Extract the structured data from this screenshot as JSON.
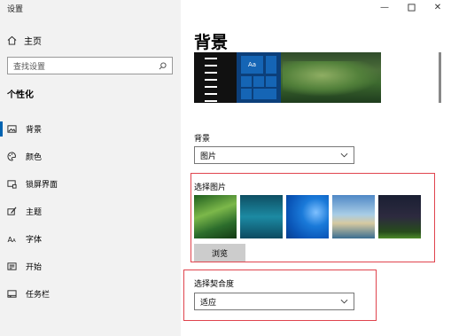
{
  "window": {
    "title": "设置",
    "minimize_glyph": "—",
    "close_glyph": "✕"
  },
  "sidebar": {
    "home_label": "主页",
    "search_placeholder": "查找设置",
    "section_title": "个性化",
    "items": [
      {
        "label": "背景",
        "icon": "image-icon",
        "active": true
      },
      {
        "label": "颜色",
        "icon": "palette-icon",
        "active": false
      },
      {
        "label": "锁屏界面",
        "icon": "lock-screen-icon",
        "active": false
      },
      {
        "label": "主题",
        "icon": "theme-icon",
        "active": false
      },
      {
        "label": "字体",
        "icon": "font-icon",
        "active": false
      },
      {
        "label": "开始",
        "icon": "start-icon",
        "active": false
      },
      {
        "label": "任务栏",
        "icon": "taskbar-icon",
        "active": false
      }
    ]
  },
  "main": {
    "title": "背景",
    "preview_tile_text": "Aa",
    "background_label": "背景",
    "background_value": "图片",
    "choose_picture_label": "选择图片",
    "browse_label": "浏览",
    "fit_label": "选择契合度",
    "fit_value": "适应"
  },
  "colors": {
    "accent": "#0063b1",
    "highlight_box": "#e0444e"
  }
}
